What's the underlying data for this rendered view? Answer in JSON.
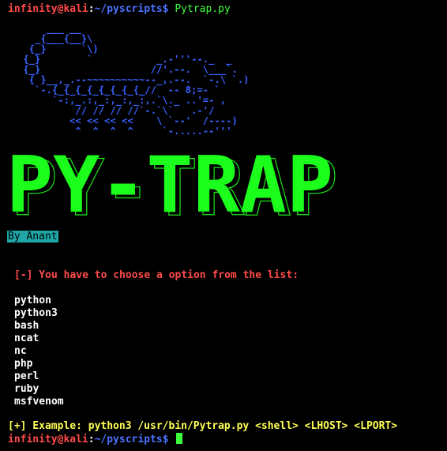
{
  "prompt": {
    "user_host": "infinity@kali",
    "colon": ":",
    "path": "~/pyscripts",
    "dollar": "$",
    "command": "Pytrap.py"
  },
  "ascii_art": "     ___ __\n   _{___{__}\\\n  {_}      `\\)\n {_}        `           _.-'''--._  _\n {_}                   //'.--.  \\___`.\n  { }__,_.--~~~~~~~~~~--_,.--.  `-.\\ `.)\n   `-.{_{_{_{_{_{_{_{_//  -- 8;=- `\n      `-:,_.:,_:,_:,_:,.`\\._ ..'=- ,\n          // // // //`-.`\\`   .-'/\n         << << << <<    \\ `--'  /----)\n          ^  ^  ^  ^     `-.....--'''",
  "banner_text": "PY-TRAP",
  "byline": "By Anant",
  "choose_message": "[-] You have to choose a option from the list:",
  "options": [
    "python",
    "python3",
    "bash",
    "ncat",
    "nc",
    "php",
    "perl",
    "ruby",
    "msfvenom"
  ],
  "example": "[+] Example: python3 /usr/bin/Pytrap.py <shell> <LHOST> <LPORT>",
  "colors": {
    "background": "#000000",
    "prompt_user": "#ff4b4b",
    "prompt_path": "#4d72ff",
    "banner": "#1cff1c",
    "byline_bg": "#1fa7a7",
    "error": "#ff4b4b",
    "example": "#ffff55"
  }
}
